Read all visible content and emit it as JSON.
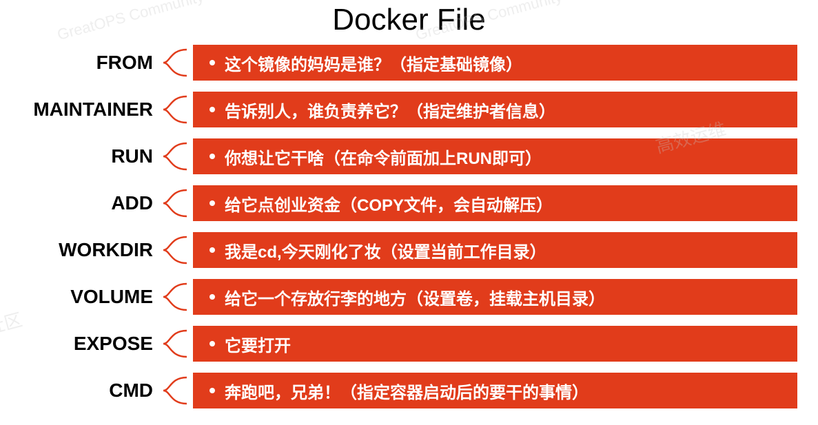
{
  "title": "Docker File",
  "rows": [
    {
      "label": "FROM",
      "desc": "这个镜像的妈妈是谁？（指定基础镜像）"
    },
    {
      "label": "MAINTAINER",
      "desc": "告诉别人，谁负责养它？（指定维护者信息）"
    },
    {
      "label": "RUN",
      "desc": "你想让它干啥（在命令前面加上RUN即可）"
    },
    {
      "label": "ADD",
      "desc": "给它点创业资金（COPY文件，会自动解压）"
    },
    {
      "label": "WORKDIR",
      "desc": "我是cd,今天刚化了妆（设置当前工作目录）"
    },
    {
      "label": "VOLUME",
      "desc": "给它一个存放行李的地方（设置卷，挂载主机目录）"
    },
    {
      "label": "EXPOSE",
      "desc": "它要打开"
    },
    {
      "label": "CMD",
      "desc": "奔跑吧，兄弟！（指定容器启动后的要干的事情）"
    }
  ],
  "watermark_text": "GreatOPS Community",
  "colors": {
    "accent": "#e13c1b"
  }
}
